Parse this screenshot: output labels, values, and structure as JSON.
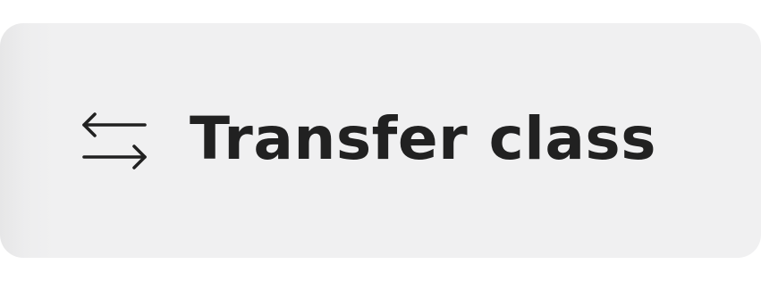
{
  "button": {
    "label": "Transfer class",
    "icon": "transfer-arrows-icon"
  },
  "colors": {
    "background": "#f0f0f1",
    "text": "#212121"
  }
}
